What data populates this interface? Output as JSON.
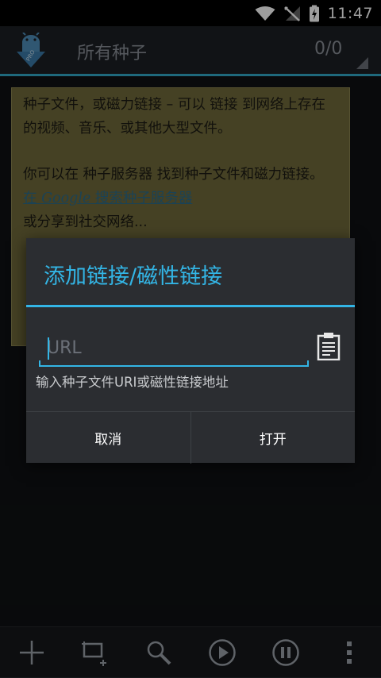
{
  "status_bar": {
    "time": "11:47"
  },
  "action_bar": {
    "title": "所有种子",
    "count": "0/0"
  },
  "note": {
    "line1": "种子文件，或磁力链接 – 可以 链接 到网络上存在的视频、音乐、或其他大型文件。",
    "line2": " 你可以在 种子服务器 找到种子文件和磁力链接。",
    "link_prefix": "在 ",
    "link_google": "Google",
    "link_suffix": " 搜索种子服务器",
    "line3": "或分享到社交网络..."
  },
  "dialog": {
    "title": "添加链接/磁性链接",
    "url_placeholder": "URL",
    "url_value": "",
    "hint": "输入种子文件URI或磁性链接地址",
    "cancel_label": "取消",
    "open_label": "打开"
  },
  "colors": {
    "accent": "#33b5e5",
    "note_bg": "#706a3a"
  },
  "toolbar": {
    "icons": [
      "add-icon",
      "add-multiple-icon",
      "search-icon",
      "play-icon",
      "pause-icon",
      "overflow-menu-icon"
    ]
  }
}
